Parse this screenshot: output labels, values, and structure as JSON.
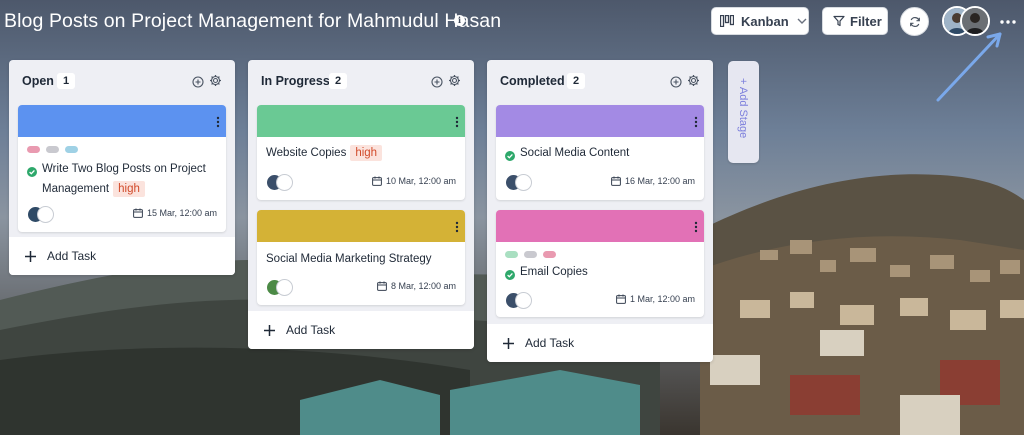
{
  "board": {
    "title": "Blog Posts on Project Management for Mahmudul Hasan"
  },
  "toolbar": {
    "view_label": "Kanban",
    "filter_label": "Filter"
  },
  "columns": [
    {
      "title": "Open",
      "count": "1",
      "add_task_label": "Add Task",
      "cards": [
        {
          "band_color": "#5c92f0",
          "labels": [
            "#e99ab0",
            "#c9c9cf",
            "#9fd1e5"
          ],
          "task_line1": "Write Two Blog Posts on Project",
          "task_line2": "Management",
          "priority": "high",
          "due": "15 Mar, 12:00 am"
        }
      ]
    },
    {
      "title": "In Progress",
      "count": "2",
      "add_task_label": "Add Task",
      "cards": [
        {
          "band_color": "#6ac994",
          "task_line1": "Website Copies",
          "priority": "high",
          "due": "10 Mar, 12:00 am"
        },
        {
          "band_color": "#d4b236",
          "task_line1": "Social Media Marketing Strategy",
          "due": "8 Mar, 12:00 am"
        }
      ]
    },
    {
      "title": "Completed",
      "count": "2",
      "add_task_label": "Add Task",
      "cards": [
        {
          "band_color": "#a38ae4",
          "task_line1": "Social Media Content",
          "due": "16 Mar, 12:00 am"
        },
        {
          "band_color": "#e271b6",
          "labels": [
            "#a9dfc1",
            "#c9c9cf",
            "#e99ab0"
          ],
          "task_line1": "Email Copies",
          "due": "1 Mar, 12:00 am"
        }
      ]
    }
  ],
  "add_stage_label": "+ Add Stage",
  "colors": {
    "check_green": "#2ea86b",
    "priority_text": "#d24b2b",
    "priority_bg": "#fbe3dd",
    "annotation_arrow": "#7aa8ea",
    "add_stage_text": "#7c7fdc"
  },
  "icons": [
    "info-icon",
    "kanban-icon",
    "chevron-down-icon",
    "filter-icon",
    "refresh-icon",
    "more-icon",
    "plus-circle-icon",
    "gear-icon",
    "check-circle-icon",
    "calendar-icon",
    "plus-icon",
    "kebab-menu-icon"
  ]
}
